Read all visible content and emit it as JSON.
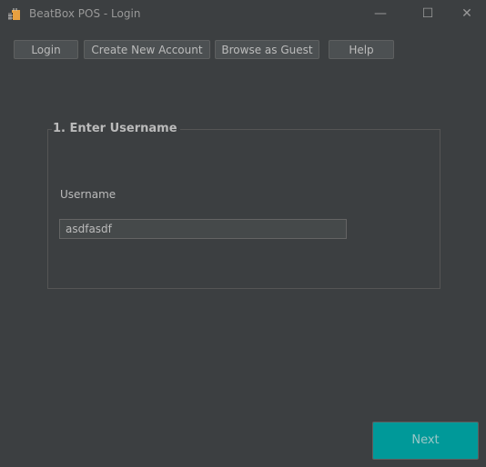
{
  "window": {
    "title": "BeatBox POS - Login",
    "minimize": "—",
    "maximize": "☐",
    "close": "✕"
  },
  "toolbar": {
    "login": "Login",
    "create_account": "Create New Account",
    "browse_guest": "Browse as Guest",
    "help": "Help"
  },
  "panel": {
    "title": "1. Enter Username",
    "username_label": "Username",
    "username_value": "asdfasdf"
  },
  "footer": {
    "next": "Next"
  },
  "colors": {
    "background": "#3c3f41",
    "accent": "#009999"
  }
}
